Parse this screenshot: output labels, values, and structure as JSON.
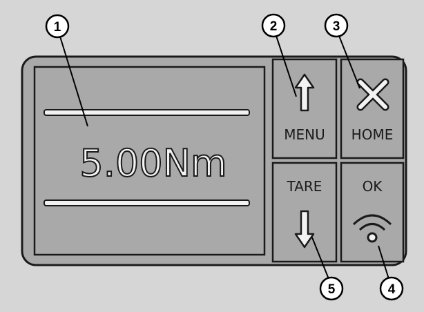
{
  "display": {
    "readout": "5.00Nm"
  },
  "buttons": {
    "menu": {
      "label": "MENU",
      "icon": "arrow-up-icon"
    },
    "home": {
      "label": "HOME",
      "icon": "close-x-icon"
    },
    "tare": {
      "label": "TARE",
      "icon": "arrow-down-icon"
    },
    "ok": {
      "label": "OK",
      "icon": "wireless-icon"
    }
  },
  "callouts": [
    "1",
    "2",
    "3",
    "4",
    "5"
  ],
  "colors": {
    "panel": "#a9a9a9",
    "background": "#d6d6d6",
    "outline": "#1a1a1a"
  }
}
